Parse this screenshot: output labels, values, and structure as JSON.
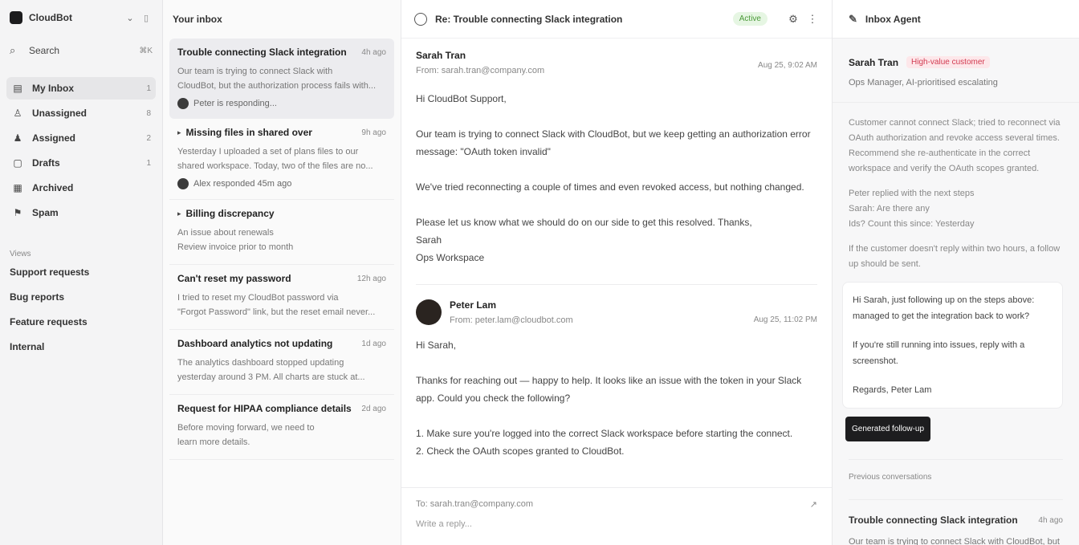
{
  "sidebar": {
    "workspace": "CloudBot",
    "search": {
      "label": "Search",
      "shortcut": "⌘K"
    },
    "nav": [
      {
        "icon": "inbox-icon",
        "label": "My Inbox",
        "count": "1"
      },
      {
        "icon": "person-icon",
        "label": "Unassigned",
        "count": "8"
      },
      {
        "icon": "assigned-icon",
        "label": "Assigned",
        "count": "2"
      },
      {
        "icon": "draft-icon",
        "label": "Drafts",
        "count": "1"
      },
      {
        "icon": "archive-icon",
        "label": "Archived",
        "count": ""
      },
      {
        "icon": "spam-icon",
        "label": "Spam",
        "count": ""
      }
    ],
    "views_header": "Views",
    "views": [
      "Support requests",
      "Bug reports",
      "Feature requests",
      "Internal"
    ]
  },
  "inbox": {
    "title": "Your inbox",
    "conversations": [
      {
        "title": "Trouble connecting Slack integration",
        "time": "4h ago",
        "preview1": "Our team is trying to connect Slack with",
        "preview2": "CloudBot, but the authorization process fails with...",
        "status": "Peter is responding..."
      },
      {
        "title": "Missing files in shared over",
        "time": "9h ago",
        "preview1": "Yesterday I uploaded a set of plans files to our",
        "preview2": "shared workspace. Today, two of the files are no...",
        "status": "Alex responded 45m ago"
      },
      {
        "title": "Billing discrepancy",
        "time": "",
        "preview1": "An issue about renewals",
        "preview2": "Review invoice prior to month",
        "status": ""
      },
      {
        "title": "Can't reset my password",
        "time": "12h ago",
        "preview1": "I tried to reset my CloudBot password via",
        "preview2": "\"Forgot Password\" link, but the reset email never...",
        "status": ""
      },
      {
        "title": "Dashboard analytics not updating",
        "time": "1d ago",
        "preview1": "The analytics dashboard stopped updating",
        "preview2": "yesterday around 3 PM. All charts are stuck at...",
        "status": ""
      },
      {
        "title": "Request for HIPAA compliance details",
        "time": "2d ago",
        "preview1": "Before moving forward, we need to",
        "preview2": "learn more details.",
        "status": ""
      }
    ]
  },
  "thread": {
    "title": "Re: Trouble connecting Slack integration",
    "status": "Active",
    "messages": [
      {
        "name": "Sarah Tran",
        "from": "From: sarah.tran@company.com",
        "date": "Aug 25, 9:02 AM",
        "body": [
          "Hi CloudBot Support,",
          "Our team is trying to connect Slack with CloudBot, but we keep getting an authorization error message: \"OAuth token invalid\"",
          "We've tried reconnecting a couple of times and even revoked access, but nothing changed.",
          "Please let us know what we should do on our side to get this resolved. Thanks,\nSarah\nOps Workspace"
        ]
      },
      {
        "name": "Peter Lam",
        "from": "From: peter.lam@cloudbot.com",
        "date": "Aug 25, 11:02 PM",
        "body": [
          "Hi Sarah,",
          "Thanks for reaching out — happy to help. It looks like an issue with the token in your Slack app. Could you check the following?",
          "1. Make sure you're logged into the correct Slack workspace before starting the connect.",
          "2. Check the OAuth scopes granted to CloudBot."
        ]
      }
    ],
    "composer": {
      "to": "To: sarah.tran@company.com",
      "expand": "↗",
      "placeholder": "Write a reply..."
    }
  },
  "agent": {
    "title": "Inbox Agent",
    "customer": {
      "name": "Sarah Tran",
      "badge": "High-value customer",
      "meta": "Ops Manager, AI-prioritised escalating"
    },
    "summary": "Customer cannot connect Slack; tried to reconnect via OAuth authorization and revoke access several times. Recommend she re-authenticate in the correct workspace and verify the OAuth scopes granted.",
    "notes": [
      "Peter replied with the next steps",
      "Sarah: Are there any",
      "Ids? Count this since: Yesterday"
    ],
    "followup_note": "If the customer doesn't reply within two hours, a follow up should be sent.",
    "draft": [
      "Hi Sarah, just following up on the steps above: managed to get the integration back to work?",
      "If you're still running into issues, reply with a screenshot.",
      "Regards, Peter Lam"
    ],
    "draft_button": "Generated follow-up",
    "previous_header": "Previous conversations",
    "previous": {
      "title": "Trouble connecting Slack integration",
      "time": "4h ago",
      "body": "Our team is trying to connect Slack with CloudBot, but the authorization process fails with..."
    }
  }
}
